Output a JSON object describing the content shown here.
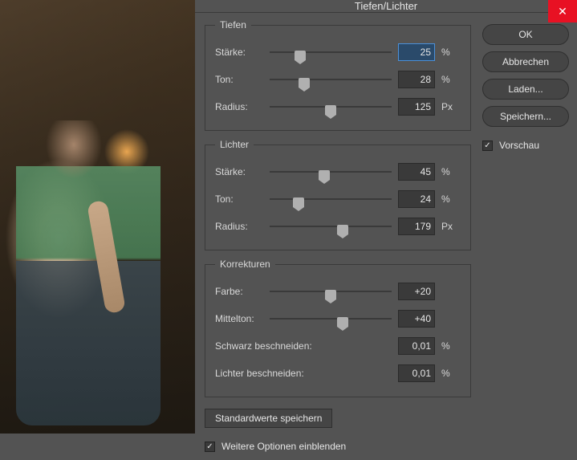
{
  "title": "Tiefen/Lichter",
  "groups": {
    "shadows": {
      "legend": "Tiefen",
      "strength_label": "Stärke:",
      "strength_value": "25",
      "strength_unit": "%",
      "strength_pct": 25,
      "tone_label": "Ton:",
      "tone_value": "28",
      "tone_unit": "%",
      "tone_pct": 28,
      "radius_label": "Radius:",
      "radius_value": "125",
      "radius_unit": "Px",
      "radius_pct": 50
    },
    "highlights": {
      "legend": "Lichter",
      "strength_label": "Stärke:",
      "strength_value": "45",
      "strength_unit": "%",
      "strength_pct": 45,
      "tone_label": "Ton:",
      "tone_value": "24",
      "tone_unit": "%",
      "tone_pct": 24,
      "radius_label": "Radius:",
      "radius_value": "179",
      "radius_unit": "Px",
      "radius_pct": 60
    },
    "adjust": {
      "legend": "Korrekturen",
      "color_label": "Farbe:",
      "color_value": "+20",
      "color_pct": 50,
      "midtone_label": "Mittelton:",
      "midtone_value": "+40",
      "midtone_pct": 60,
      "blackclip_label": "Schwarz beschneiden:",
      "blackclip_value": "0,01",
      "blackclip_unit": "%",
      "whiteclip_label": "Lichter beschneiden:",
      "whiteclip_value": "0,01",
      "whiteclip_unit": "%"
    }
  },
  "save_defaults": "Standardwerte speichern",
  "show_more": "Weitere Optionen einblenden",
  "show_more_checked": true,
  "buttons": {
    "ok": "OK",
    "cancel": "Abbrechen",
    "load": "Laden...",
    "save": "Speichern..."
  },
  "preview": {
    "label": "Vorschau",
    "checked": true
  }
}
